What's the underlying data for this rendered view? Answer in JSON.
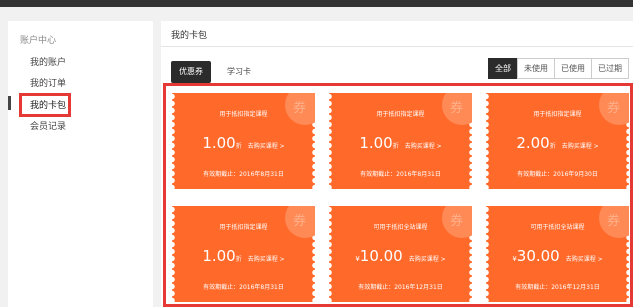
{
  "sidebar": {
    "title": "账户中心",
    "items": [
      "我的账户",
      "我的订单",
      "我的卡包",
      "会员记录"
    ]
  },
  "main": {
    "title": "我的卡包",
    "tabs": [
      "优惠券",
      "学习卡"
    ],
    "filters": [
      "全部",
      "未使用",
      "已使用",
      "已过期"
    ]
  },
  "coupons": [
    {
      "head": "用于抵扣指定课程",
      "currency": "",
      "amount": "1.00",
      "unit": "折",
      "link": "去购买课程 >",
      "expires": "有效期截止：2016年8月31日"
    },
    {
      "head": "用于抵扣指定课程",
      "currency": "",
      "amount": "1.00",
      "unit": "折",
      "link": "去购买课程 >",
      "expires": "有效期截止：2016年8月31日"
    },
    {
      "head": "用于抵扣指定课程",
      "currency": "",
      "amount": "2.00",
      "unit": "折",
      "link": "去购买课程 >",
      "expires": "有效期截止：2016年9月30日"
    },
    {
      "head": "用于抵扣指定课程",
      "currency": "",
      "amount": "1.00",
      "unit": "折",
      "link": "去购买课程 >",
      "expires": "有效期截止：2016年8月31日"
    },
    {
      "head": "可用于抵扣全站课程",
      "currency": "¥",
      "amount": "10.00",
      "unit": "",
      "link": "去购买课程 >",
      "expires": "有效期截止：2016年12月31日"
    },
    {
      "head": "可用于抵扣全站课程",
      "currency": "¥",
      "amount": "30.00",
      "unit": "",
      "link": "去购买课程 >",
      "expires": "有效期截止：2016年12月31日"
    }
  ],
  "seal_char": "券",
  "colors": {
    "coupon": "#ff6a2b",
    "highlight": "#e53935",
    "active_tab": "#2b2b2b"
  }
}
